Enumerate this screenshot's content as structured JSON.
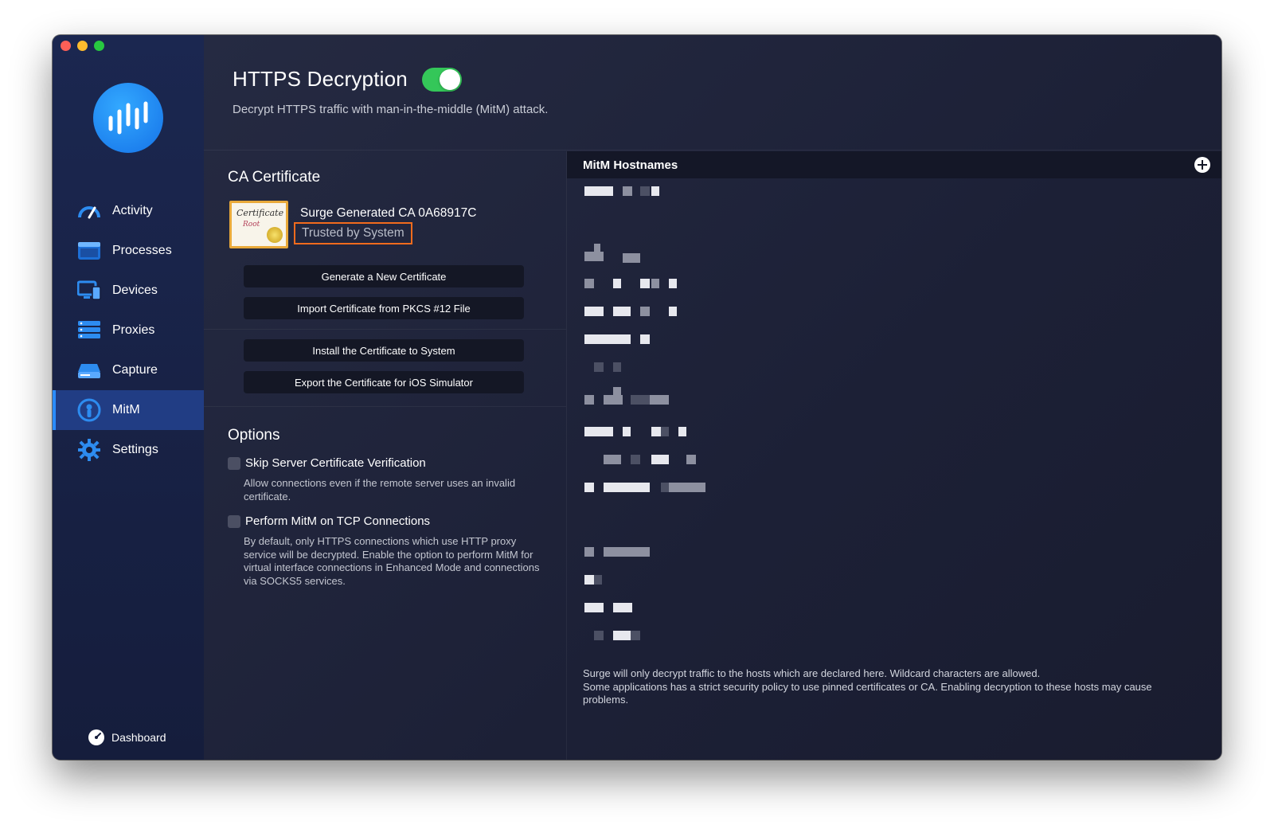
{
  "window": {
    "traffic_lights": [
      "close",
      "minimize",
      "maximize"
    ]
  },
  "sidebar": {
    "logo_icon": "waveform-logo-icon",
    "items": [
      {
        "label": "Activity",
        "icon": "speedometer-icon",
        "active": false
      },
      {
        "label": "Processes",
        "icon": "window-icon",
        "active": false
      },
      {
        "label": "Devices",
        "icon": "devices-icon",
        "active": false
      },
      {
        "label": "Proxies",
        "icon": "server-icon",
        "active": false
      },
      {
        "label": "Capture",
        "icon": "drive-icon",
        "active": false
      },
      {
        "label": "MitM",
        "icon": "mitm-icon",
        "active": true
      },
      {
        "label": "Settings",
        "icon": "gear-icon",
        "active": false
      }
    ],
    "dashboard_label": "Dashboard"
  },
  "header": {
    "title": "HTTPS Decryption",
    "enabled": true,
    "subtitle": "Decrypt HTTPS traffic with man-in-the-middle (MitM) attack."
  },
  "ca_certificate": {
    "section_title": "CA Certificate",
    "image_text": [
      "Certificate",
      "Root"
    ],
    "name": "Surge Generated CA 0A68917C",
    "status": "Trusted by System",
    "buttons": {
      "generate": "Generate a New Certificate",
      "import": "Import Certificate from PKCS #12 File",
      "install": "Install the Certificate to System",
      "export": "Export the Certificate for iOS Simulator"
    }
  },
  "options": {
    "section_title": "Options",
    "items": [
      {
        "label": "Skip Server Certificate Verification",
        "checked": false,
        "description": "Allow connections even if the remote server uses an invalid certificate."
      },
      {
        "label": "Perform MitM on TCP Connections",
        "checked": false,
        "description": "By default, only HTTPS connections which use HTTP proxy service will be decrypted. Enable the option to perform MitM for virtual interface connections in Enhanced Mode and connections via SOCKS5 services."
      }
    ]
  },
  "hostnames": {
    "title": "MitM Hostnames",
    "add_icon": "plus-circle-icon",
    "note_line1": "Surge will only decrypt traffic to the hosts which are declared here. Wildcard characters are allowed.",
    "note_line2": "Some applications has a strict security policy to use pinned certificates or CA. Enabling decryption to these hosts may cause problems."
  },
  "colors": {
    "accent": "#2b8cff",
    "toggle_on": "#34c759",
    "highlight_border": "#f26b1d",
    "sidebar_bg": "#1b2750",
    "main_bg": "#1f2337"
  }
}
